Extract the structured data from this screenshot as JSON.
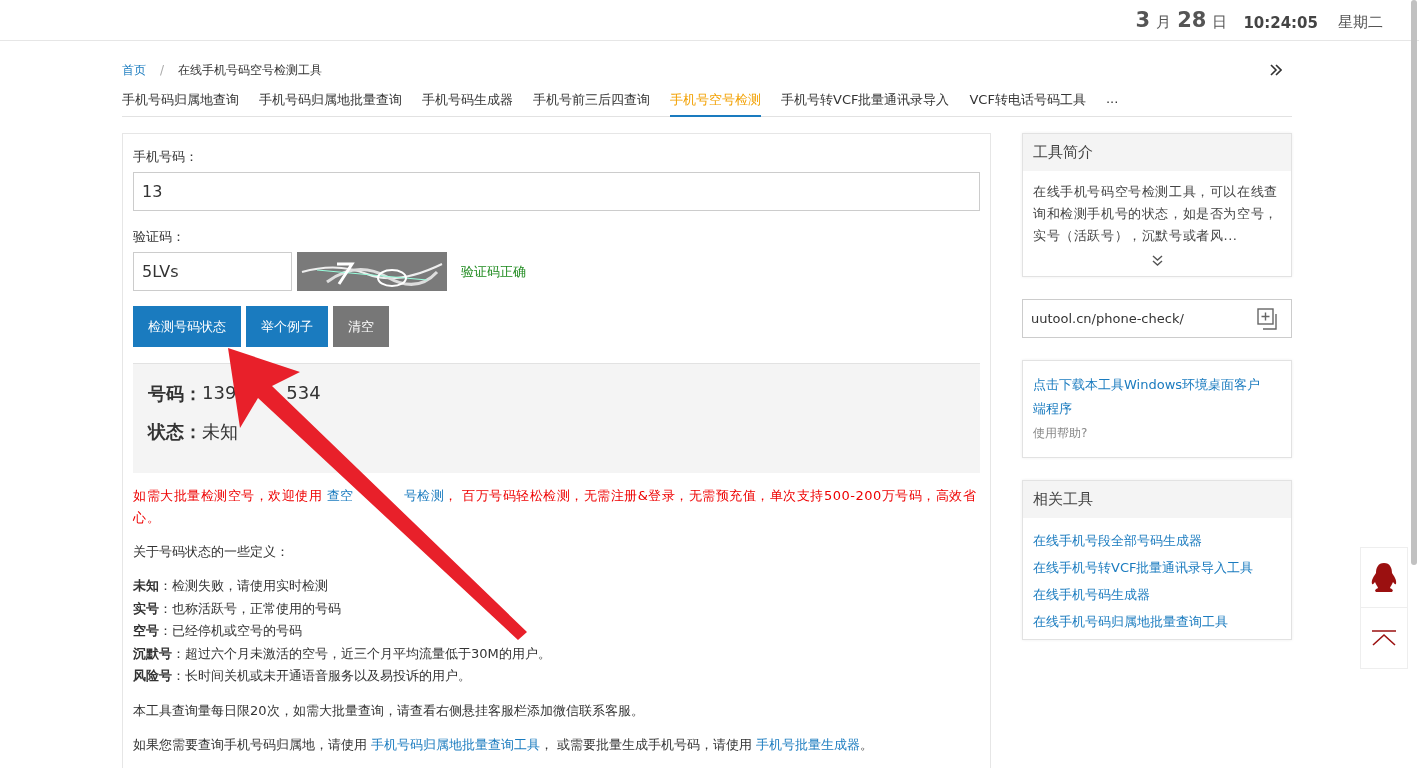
{
  "header": {
    "month": "3",
    "month_unit": "月",
    "day": "28",
    "day_unit": "日",
    "time": "10:24:05",
    "weekday": "星期二"
  },
  "breadcrumb": {
    "home": "首页",
    "separator": "/",
    "current": "在线手机号码空号检测工具"
  },
  "tabs": [
    {
      "label": "手机号码归属地查询",
      "selected": false
    },
    {
      "label": "手机号码归属地批量查询",
      "selected": false
    },
    {
      "label": "手机号码生成器",
      "selected": false
    },
    {
      "label": "手机号前三后四查询",
      "selected": false
    },
    {
      "label": "手机号空号检测",
      "selected": true
    },
    {
      "label": "手机号转VCF批量通讯录导入",
      "selected": false
    },
    {
      "label": "VCF转电话号码工具",
      "selected": false
    }
  ],
  "tabs_more": "...",
  "form": {
    "phone_label": "手机号码：",
    "phone_value": "13",
    "captcha_label": "验证码：",
    "captcha_value": "5LVs",
    "captcha_status": "验证码正确",
    "buttons": [
      {
        "label": "检测号码状态",
        "kind": "primary"
      },
      {
        "label": "举个例子",
        "kind": "primary"
      },
      {
        "label": "清空",
        "kind": "secondary"
      }
    ]
  },
  "result": [
    {
      "label": "号码：",
      "parts": [
        "139",
        "534"
      ]
    },
    {
      "label": "状态：",
      "parts": [
        "未知"
      ]
    }
  ],
  "notice": [
    {
      "kind": "text",
      "text": "如需大批量检测空号，欢迎使用 "
    },
    {
      "kind": "link",
      "text": "查空"
    },
    {
      "kind": "gap"
    },
    {
      "kind": "link",
      "text": "号检测"
    },
    {
      "kind": "text",
      "text": "， 百万号码轻松检测，无需注册&登录，无需预充值，单次支持500-200万号码，高效省心。"
    }
  ],
  "definitions_intro": "关于号码状态的一些定义：",
  "definitions": [
    "**未知**：检测失败，请使用实时检测",
    "**实号**：也称活跃号，正常使用的号码",
    "**空号**：已经停机或空号的号码",
    "**沉默号**：超过六个月未激活的空号，近三个月平均流量低于30M的用户。",
    "**风险号**：长时间关机或未开通语音服务以及易投诉的用户。"
  ],
  "limit_text": "本工具查询量每日限20次，如需大批量查询，请查看右侧悬挂客服栏添加微信联系客服。",
  "footer_text": [
    {
      "kind": "text",
      "text": "如果您需要查询手机号码归属地，请使用 "
    },
    {
      "kind": "link",
      "text": "手机号码归属地批量查询工具"
    },
    {
      "kind": "text",
      "text": "， 或需要批量生成手机号码，请使用 "
    },
    {
      "kind": "link",
      "text": "手机号批量生成器"
    },
    {
      "kind": "text",
      "text": "。"
    }
  ],
  "intro_card": {
    "title": "工具简介",
    "text": "在线手机号码空号检测工具，可以在线查询和检测手机号的状态，如是否为空号，实号（活跃号），沉默号或者风..."
  },
  "url_card": {
    "url": "uutool.cn/phone-check/"
  },
  "download_card": {
    "link": "点击下载本工具Windows环境桌面客户端程序",
    "help": "使用帮助?"
  },
  "related_card": {
    "title": "相关工具",
    "links": [
      "在线手机号段全部号码生成器",
      "在线手机号转VCF批量通讯录导入工具",
      "在线手机号码生成器",
      "在线手机号码归属地批量查询工具"
    ]
  }
}
